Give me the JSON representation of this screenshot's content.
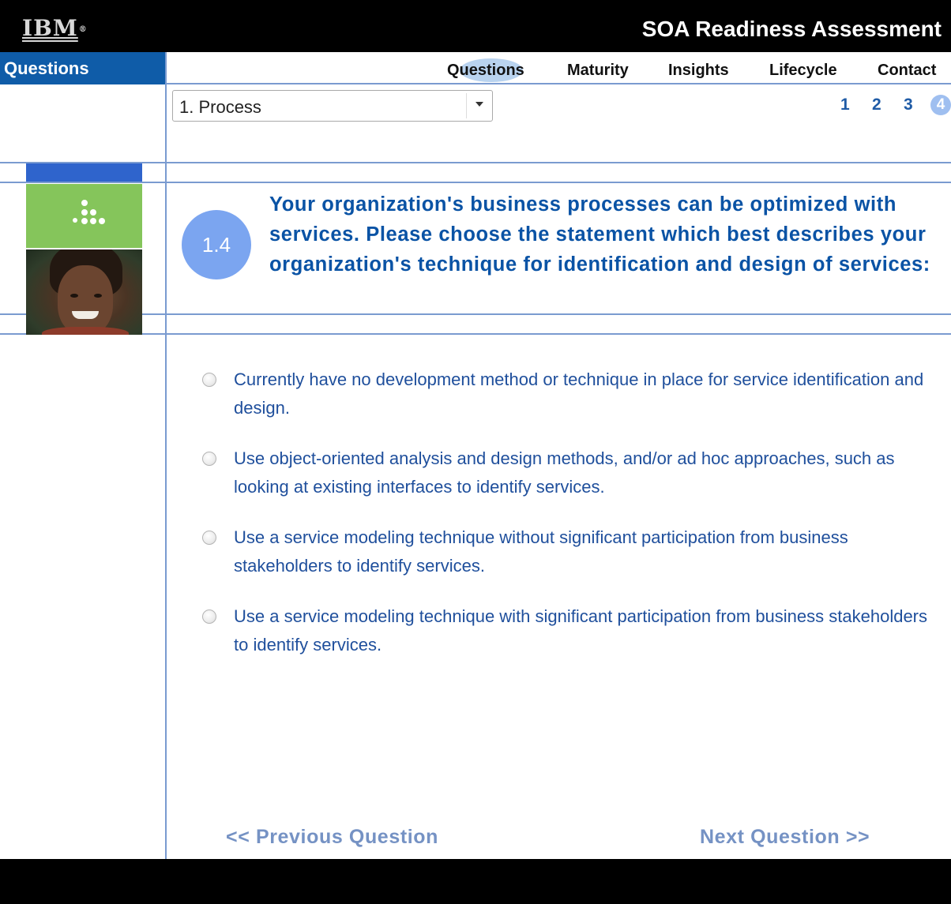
{
  "header": {
    "logo_text": "IBM",
    "logo_mark": "®",
    "app_title": "SOA Readiness Assessment"
  },
  "sidebar": {
    "section_label": "Questions"
  },
  "nav": {
    "items": [
      "Questions",
      "Maturity",
      "Insights",
      "Lifecycle",
      "Contact"
    ],
    "active": "Questions"
  },
  "category_select": {
    "selected": "1. Process"
  },
  "pager": {
    "pages": [
      "1",
      "2",
      "3",
      "4"
    ],
    "current": "4"
  },
  "question": {
    "number": "1.4",
    "text": "Your organization's business processes can be optimized with services.  Please choose the statement which best describes your organization's technique for identification and design of services:"
  },
  "options": [
    "Currently have no development method or technique in place for service identification and design.",
    "Use object-oriented analysis and design methods, and/or ad hoc approaches, such as looking at existing interfaces to identify services.",
    "Use a service modeling technique without significant participation from business stakeholders to identify services.",
    "Use a service modeling technique with significant participation from business stakeholders to identify services."
  ],
  "navigation": {
    "previous": "<< Previous Question",
    "next": "Next Question >>"
  },
  "colors": {
    "brand_blue": "#0f5ca8",
    "question_text": "#0a53a5",
    "accent_green": "#85c55b",
    "badge": "#7ba5f0"
  }
}
